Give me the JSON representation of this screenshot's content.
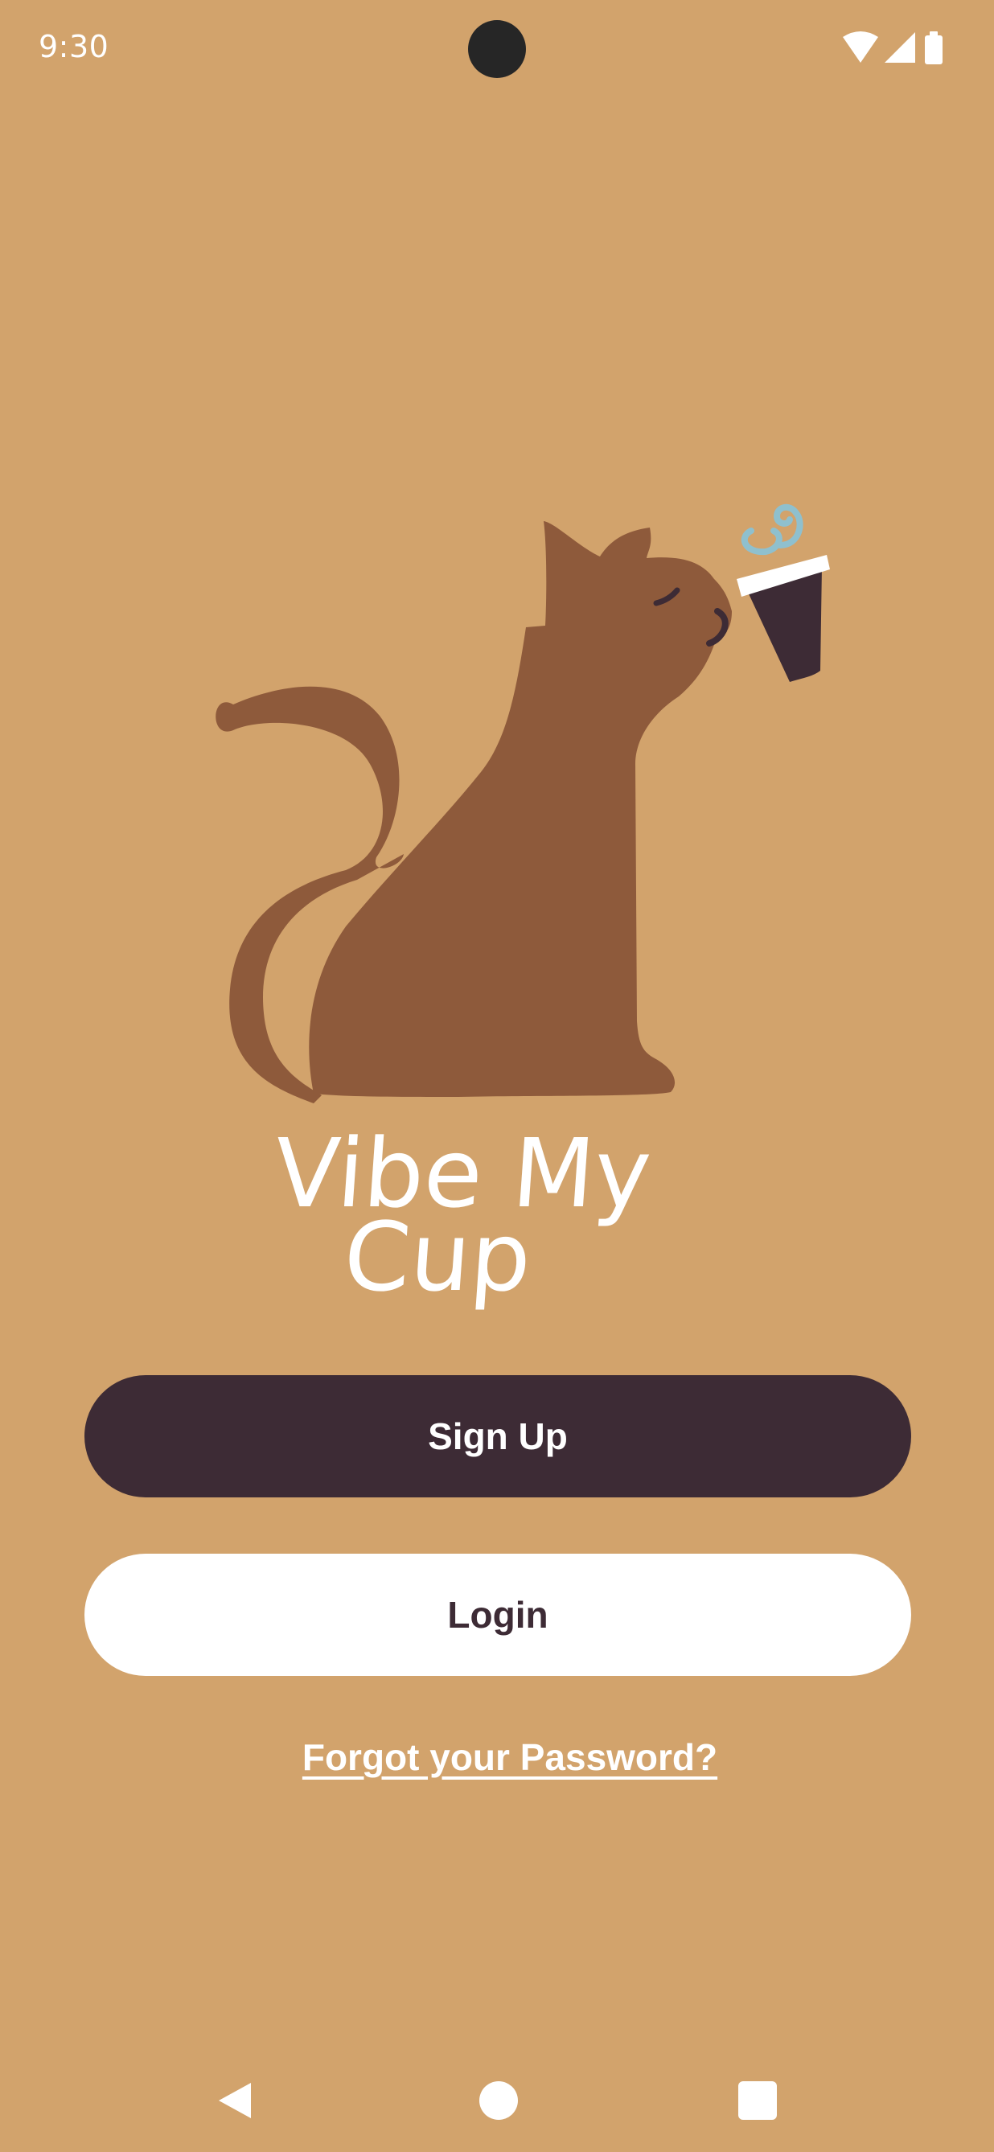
{
  "status_bar": {
    "time": "9:30",
    "icons": [
      "wifi-icon",
      "cellular-signal-icon",
      "battery-icon"
    ]
  },
  "app": {
    "title_line1": "Vibe My",
    "title_line2": "Cup"
  },
  "actions": {
    "signup_label": "Sign Up",
    "login_label": "Login",
    "forgot_label": "Forgot your Password?"
  },
  "nav": {
    "icons": [
      "back-icon",
      "home-icon",
      "recents-icon"
    ]
  },
  "colors": {
    "background": "#D2A36C",
    "cat": "#8E5A3B",
    "cup": "#3D2B35",
    "steam": "#8FC0CE",
    "primary_button": "#3D2B35",
    "secondary_button": "#FFFFFF"
  }
}
